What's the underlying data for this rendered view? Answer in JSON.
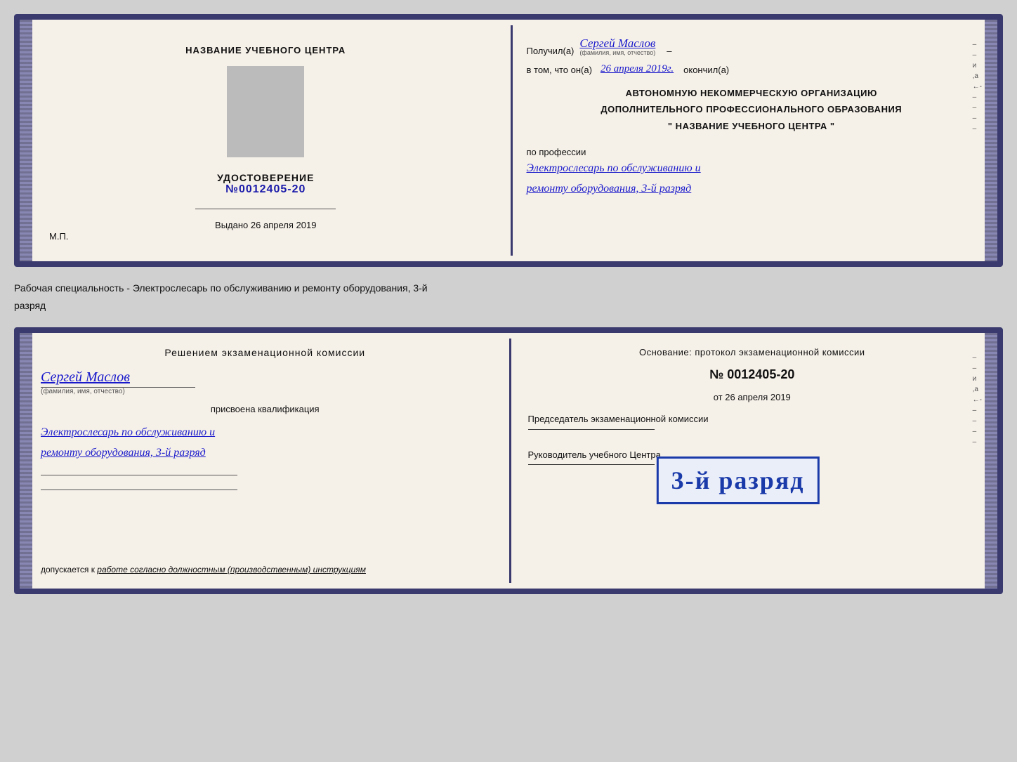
{
  "cert1": {
    "left": {
      "title": "НАЗВАНИЕ УЧЕБНОГО ЦЕНТРА",
      "photo_alt": "photo",
      "udostoverenie_label": "УДОСТОВЕРЕНИЕ",
      "number_prefix": "№",
      "number": "0012405-20",
      "vydano_label": "Выдано",
      "vydano_date": "26 апреля 2019",
      "mp": "М.П."
    },
    "right": {
      "poluchil_label": "Получил(а)",
      "recipient_name": "Сергей Маслов",
      "fio_sublabel": "(фамилия, имя, отчество)",
      "dash": "–",
      "vtom_label": "в том, что он(а)",
      "date_completed": "26 апреля 2019г.",
      "okonchill_label": "окончил(а)",
      "auto_line1": "АВТОНОМНУЮ НЕКОММЕРЧЕСКУЮ ОРГАНИЗАЦИЮ",
      "auto_line2": "ДОПОЛНИТЕЛЬНОГО ПРОФЕССИОНАЛЬНОГО ОБРАЗОВАНИЯ",
      "auto_line3": "\"   НАЗВАНИЕ УЧЕБНОГО ЦЕНТРА   \"",
      "po_professii": "по профессии",
      "profession_line1": "Электрослесарь по обслуживанию и",
      "profession_line2": "ремонту оборудования, 3-й разряд"
    }
  },
  "specialty_text": "Рабочая специальность - Электрослесарь по обслуживанию и ремонту оборудования, 3-й",
  "specialty_text2": "разряд",
  "cert2": {
    "left": {
      "resheniem_title": "Решением экзаменационной комиссии",
      "name": "Сергей Маслов",
      "fio_sublabel": "(фамилия, имя, отчество)",
      "prisvоena_label": "присвоена квалификация",
      "qualification_line1": "Электрослесарь по обслуживанию и",
      "qualification_line2": "ремонту оборудования, 3-й разряд",
      "dopuskaetsya_label": "допускается к",
      "dopuskaetsya_value": "работе согласно должностным (производственным) инструкциям"
    },
    "right": {
      "osnovanie_label": "Основание: протокол экзаменационной комиссии",
      "number_prefix": "№",
      "number": "0012405-20",
      "ot_label": "от",
      "ot_date": "26 апреля 2019",
      "predsedatel_label": "Председатель экзаменационной комиссии",
      "rukovoditel_label": "Руководитель учебного Центра"
    },
    "stamp": {
      "text": "3-й разряд"
    }
  }
}
